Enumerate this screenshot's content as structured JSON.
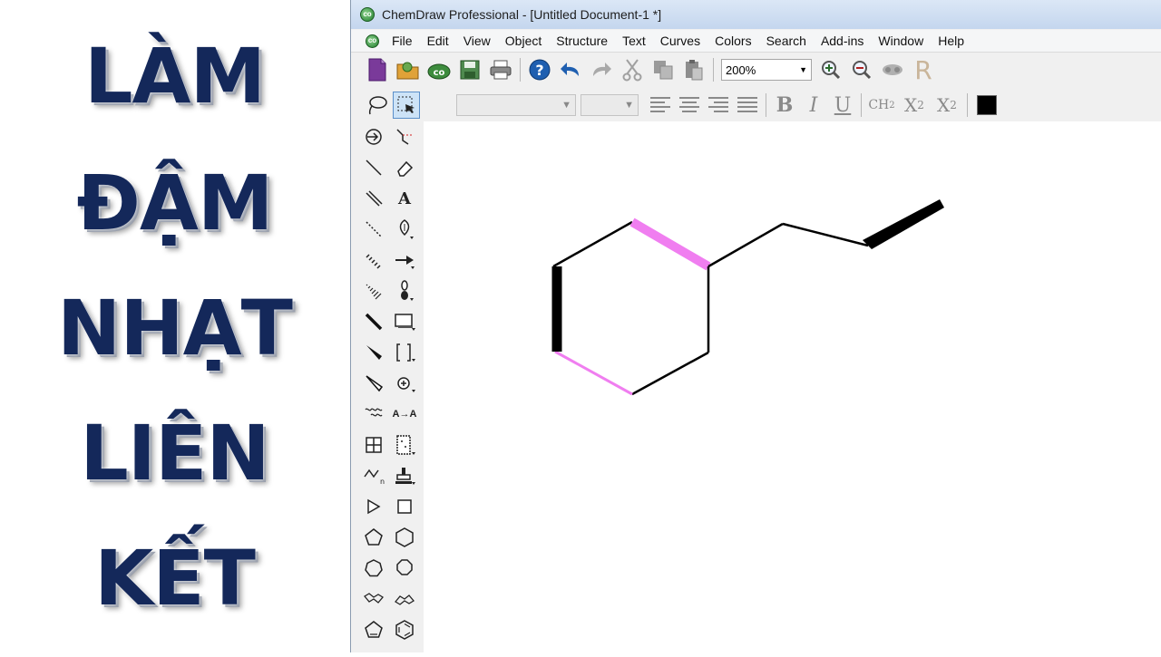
{
  "caption": {
    "lines": [
      "LÀM",
      "ĐẬM",
      "NHẠT",
      "LIÊN",
      "KẾT"
    ],
    "color": "#14285a"
  },
  "window": {
    "title": "ChemDraw Professional - [Untitled Document-1 *]"
  },
  "menu": {
    "items": [
      "File",
      "Edit",
      "View",
      "Object",
      "Structure",
      "Text",
      "Curves",
      "Colors",
      "Search",
      "Add-ins",
      "Window",
      "Help"
    ]
  },
  "toolbar": {
    "zoom_value": "200%",
    "icons": [
      "new-document-icon",
      "open-icon",
      "chemdraw-logo-icon",
      "save-icon",
      "print-icon",
      "help-icon",
      "undo-icon",
      "redo-icon",
      "cut-icon",
      "copy-icon",
      "paste-icon",
      "zoom-in-icon",
      "zoom-out-icon",
      "show-stereo-icon",
      "r-group-icon"
    ]
  },
  "format_toolbar": {
    "bold_label": "B",
    "italic_label": "I",
    "underline_label": "U",
    "formula_label": "CH",
    "formula_sub": "2",
    "subscript_label": "X",
    "subscript_sub": "2",
    "superscript_label": "X",
    "superscript_sup": "2",
    "color_swatch": "#000000"
  },
  "tool_palette": {
    "text_tool_label": "A",
    "atom_map_label": "A→A",
    "tools": [
      "lasso-icon",
      "marquee-select-icon",
      "structure-perspective-icon",
      "chain-icon",
      "solid-bond-icon",
      "eraser-icon",
      "double-bond-icon",
      "text-tool-icon",
      "dashed-bond-icon",
      "pen-icon",
      "hashed-bond-icon",
      "arrow-icon",
      "hashed-wedge-icon",
      "orbital-icon",
      "bold-bond-icon",
      "drawing-element-icon",
      "wedge-bond-icon",
      "bracket-icon",
      "hollow-wedge-icon",
      "chemical-symbol-icon",
      "wavy-bond-icon",
      "atom-map-icon",
      "table-icon",
      "tlc-plate-icon",
      "acyclic-chain-icon",
      "stamp-template-icon",
      "play-icon",
      "square-icon",
      "cyclopentane-icon",
      "cyclohexane-icon",
      "cycloheptane-icon",
      "cyclooctane-icon",
      "chair-cyclohexane-1-icon",
      "chair-cyclohexane-2-icon",
      "cyclopentadiene-icon",
      "benzene-icon"
    ]
  },
  "molecule": {
    "highlight_color": "#f07ef0",
    "bond_color": "#000000"
  }
}
